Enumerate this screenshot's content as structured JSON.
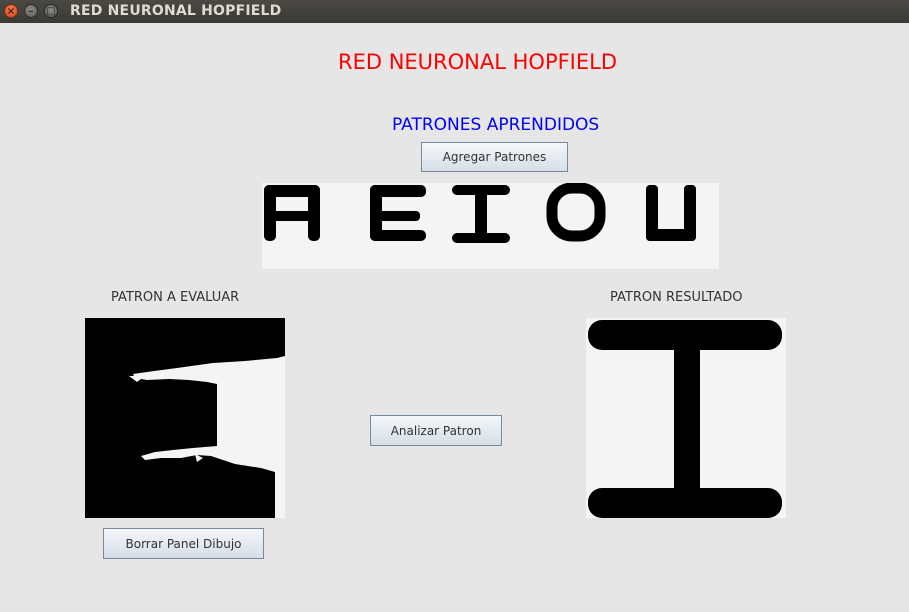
{
  "window": {
    "title": "RED NEURONAL HOPFIELD"
  },
  "header": {
    "main_title": "RED NEURONAL HOPFIELD",
    "learned_title": "PATRONES APRENDIDOS"
  },
  "buttons": {
    "add_patterns": "Agregar Patrones",
    "analyze": "Analizar Patron",
    "clear_draw": "Borrar Panel Dibujo"
  },
  "panels": {
    "input_label": "PATRON A EVALUAR",
    "result_label": "PATRON RESULTADO"
  },
  "learned_patterns": [
    "A",
    "E",
    "I",
    "O",
    "U"
  ],
  "colors": {
    "main_title": "#ff0000",
    "learned_title": "#0000ff",
    "background": "#e6e6e6",
    "panel": "#f4f4f4",
    "ink": "#000000"
  }
}
